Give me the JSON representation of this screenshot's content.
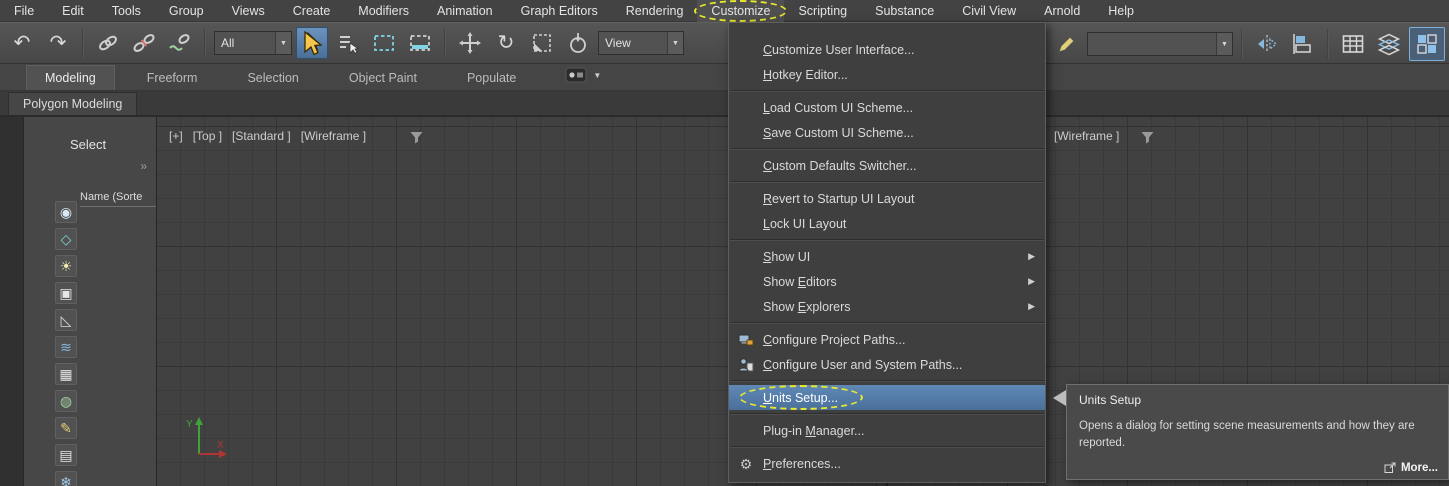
{
  "colors": {
    "annotation": "#e9e92c",
    "highlight": "#4a6f9b",
    "active-button": "#4a6f99",
    "accent": "#7fb1d8"
  },
  "icons": {
    "undo": "↶",
    "redo": "↷",
    "rotate": "↻",
    "chevron_down": "▼",
    "submenu_arrow": "▶",
    "gear": "⚙",
    "expand": "»"
  },
  "menubar": {
    "items": [
      {
        "label": "File"
      },
      {
        "label": "Edit"
      },
      {
        "label": "Tools"
      },
      {
        "label": "Group"
      },
      {
        "label": "Views"
      },
      {
        "label": "Create"
      },
      {
        "label": "Modifiers"
      },
      {
        "label": "Animation"
      },
      {
        "label": "Graph Editors"
      },
      {
        "label": "Rendering"
      },
      {
        "label": "Customize",
        "active": true,
        "annotated": true
      },
      {
        "label": "Scripting"
      },
      {
        "label": "Substance"
      },
      {
        "label": "Civil View"
      },
      {
        "label": "Arnold"
      },
      {
        "label": "Help"
      }
    ]
  },
  "toolbar": {
    "selection_filter_value": "All",
    "reference_coordinate_value": "View",
    "named_selection_value": ""
  },
  "ribbon": {
    "tabs": [
      {
        "label": "Modeling",
        "active": true
      },
      {
        "label": "Freeform"
      },
      {
        "label": "Selection"
      },
      {
        "label": "Object Paint"
      },
      {
        "label": "Populate"
      }
    ],
    "subtab": "Polygon Modeling"
  },
  "left_panel": {
    "select_label": "Select",
    "name_column_header": "Name (Sorte",
    "explorer_icons": [
      {
        "name": "display-influences-icon",
        "glyph": "◉",
        "color": "#d8e8f4"
      },
      {
        "name": "display-shapes-icon",
        "glyph": "◇",
        "color": "#7fd4d4"
      },
      {
        "name": "display-lights-icon",
        "glyph": "☀",
        "color": "#f2eab2"
      },
      {
        "name": "display-cameras-icon",
        "glyph": "▣",
        "color": "#e6e6e6"
      },
      {
        "name": "display-helpers-icon",
        "glyph": "◺",
        "color": "#d9d9d9"
      },
      {
        "name": "display-spacewarps-icon",
        "glyph": "≋",
        "color": "#86b7dd"
      },
      {
        "name": "display-geometry-icon",
        "glyph": "▦",
        "color": "#e6e6e6"
      },
      {
        "name": "display-bones-icon",
        "glyph": "◍",
        "color": "#9fd0a0"
      },
      {
        "name": "lock-cell-editing-icon",
        "glyph": "✎",
        "color": "#e3cf7a"
      },
      {
        "name": "configure-columns-icon",
        "glyph": "▤",
        "color": "#e6e6e6"
      },
      {
        "name": "display-frozen-icon",
        "glyph": "❄",
        "color": "#9ec8e8"
      }
    ]
  },
  "viewports": {
    "left_label_segments": [
      "[+]",
      "[Top ]",
      "[Standard ]",
      "[Wireframe ]"
    ],
    "right_label_segments": [
      "[Wireframe ]"
    ],
    "axis_labels": {
      "x": "X",
      "y": "Y"
    }
  },
  "customize_menu": {
    "items": [
      {
        "type": "item",
        "label": "Customize User Interface...",
        "mnemonic_index": 0
      },
      {
        "type": "item",
        "label": "Hotkey Editor...",
        "mnemonic_index": 0
      },
      {
        "type": "separator"
      },
      {
        "type": "item",
        "label": "Load Custom UI Scheme...",
        "mnemonic_index": 0
      },
      {
        "type": "item",
        "label": "Save Custom UI Scheme...",
        "mnemonic_index": 0
      },
      {
        "type": "separator"
      },
      {
        "type": "item",
        "label": "Custom Defaults Switcher...",
        "mnemonic_index": 0
      },
      {
        "type": "separator"
      },
      {
        "type": "item",
        "label": "Revert to Startup UI Layout",
        "mnemonic_index": 0
      },
      {
        "type": "item",
        "label": "Lock UI Layout",
        "mnemonic_index": 0
      },
      {
        "type": "separator"
      },
      {
        "type": "submenu",
        "label": "Show UI",
        "mnemonic_index": 0
      },
      {
        "type": "submenu",
        "label": "Show Editors",
        "mnemonic_index": 5
      },
      {
        "type": "submenu",
        "label": "Show Explorers",
        "mnemonic_index": 5
      },
      {
        "type": "separator"
      },
      {
        "type": "item",
        "label": "Configure Project Paths...",
        "mnemonic_index": 0,
        "icon": "project-paths-icon"
      },
      {
        "type": "item",
        "label": "Configure User and System Paths...",
        "mnemonic_index": 0,
        "icon": "user-paths-icon"
      },
      {
        "type": "separator"
      },
      {
        "type": "item",
        "label": "Units Setup...",
        "mnemonic_index": 0,
        "highlighted": true,
        "annotated": true
      },
      {
        "type": "separator"
      },
      {
        "type": "item",
        "label": "Plug-in Manager...",
        "mnemonic_index": 8
      },
      {
        "type": "separator"
      },
      {
        "type": "item",
        "label": "Preferences...",
        "mnemonic_index": 0,
        "icon": "gear-icon"
      }
    ]
  },
  "tooltip": {
    "title": "Units Setup",
    "body": "Opens a dialog for setting scene measurements and how they are reported.",
    "more_label": "More..."
  }
}
